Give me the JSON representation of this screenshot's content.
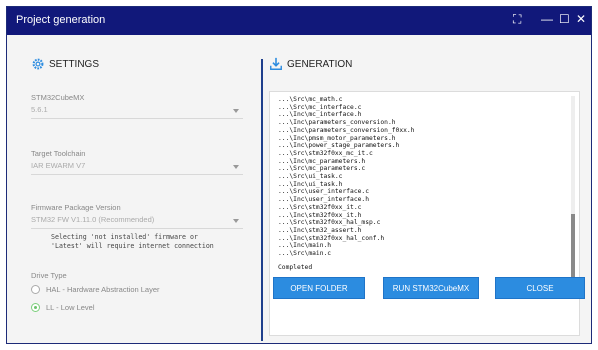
{
  "window": {
    "title": "Project generation",
    "controls": {
      "fullscreen": "⛶",
      "minimize": "—",
      "maximize": "☐",
      "close": "✕"
    }
  },
  "settings": {
    "heading": "SETTINGS",
    "cubemx_label": "STM32CubeMX",
    "cubemx_value": "5.6.1",
    "toolchain_label": "Target Toolchain",
    "toolchain_value": "IAR EWARM V7",
    "firmware_label": "Firmware Package Version",
    "firmware_value": "STM32 FW V1.11.0 (Recommended)",
    "firmware_note_1": "Selecting 'not installed' firmware or",
    "firmware_note_2": "'Latest' will require internet connection",
    "drive_label": "Drive Type",
    "drive_options": [
      "HAL - Hardware Abstraction Layer",
      "LL - Low Level"
    ],
    "drive_selected": "LL - Low Level"
  },
  "generation": {
    "heading": "GENERATION",
    "log": [
      "...\\Src\\mc_math.c",
      "...\\Src\\mc_interface.c",
      "...\\Inc\\mc_interface.h",
      "...\\Inc\\parameters_conversion.h",
      "...\\Inc\\parameters_conversion_f0xx.h",
      "...\\Inc\\pmsm_motor_parameters.h",
      "...\\Inc\\power_stage_parameters.h",
      "...\\Src\\stm32f0xx_mc_it.c",
      "...\\Inc\\mc_parameters.h",
      "...\\Src\\mc_parameters.c",
      "...\\Src\\ui_task.c",
      "...\\Inc\\ui_task.h",
      "...\\Src\\user_interface.c",
      "...\\Inc\\user_interface.h",
      "...\\Src\\stm32f0xx_it.c",
      "...\\Inc\\stm32f0xx_it.h",
      "...\\Src\\stm32f0xx_hal_msp.c",
      "...\\Inc\\stm32_assert.h",
      "...\\Inc\\stm32f0xx_hal_conf.h",
      "...\\Inc\\main.h",
      "...\\Src\\main.c"
    ],
    "status": "Completed"
  },
  "buttons": {
    "open_folder": "OPEN FOLDER",
    "run_cubemx": "RUN STM32CubeMX",
    "close": "CLOSE"
  },
  "colors": {
    "titlebar": "#11187a",
    "accent": "#2c8ce0",
    "divider": "#1f3f8c"
  }
}
